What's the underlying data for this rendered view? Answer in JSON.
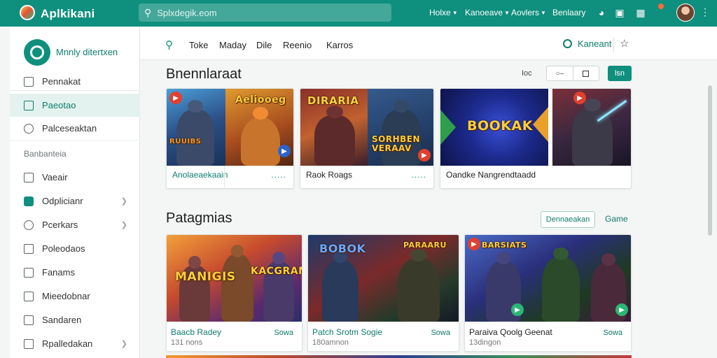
{
  "app": {
    "title": "Aplkikani"
  },
  "search": {
    "placeholder": "Splxdegik.eom"
  },
  "topnav": [
    {
      "label": "Holxe"
    },
    {
      "label": "Kanoeave"
    },
    {
      "label": "Aovlers"
    },
    {
      "label": "Benlaary"
    }
  ],
  "sidebar": {
    "profile_name": "Mnnly ditertxen",
    "items": [
      {
        "label": "Pennakat",
        "icon": "edit-icon"
      },
      {
        "label": "Paeotao",
        "icon": "calendar-icon"
      },
      {
        "label": "Palceseaktan",
        "icon": "search-icon"
      }
    ],
    "section_label": "Banbanteia",
    "items2": [
      {
        "label": "Vaeair",
        "icon": "document-icon"
      },
      {
        "label": "Odplicianr",
        "icon": "puzzle-icon"
      },
      {
        "label": "Pcerkars",
        "icon": "search-icon"
      },
      {
        "label": "Poleodaos",
        "icon": "list-icon"
      },
      {
        "label": "Fanams",
        "icon": "image-icon"
      },
      {
        "label": "Mieedobnar",
        "icon": "file-icon"
      },
      {
        "label": "Sandaren",
        "icon": "grid-icon"
      },
      {
        "label": "Rpalledakan",
        "icon": "bookmark-icon"
      }
    ]
  },
  "tabs": [
    {
      "label": "Toke"
    },
    {
      "label": "Maday"
    },
    {
      "label": "Dile"
    },
    {
      "label": "Reenio"
    },
    {
      "label": "Karros"
    }
  ],
  "header_action": {
    "label": "Kaneant"
  },
  "section1": {
    "title": "Bnennlaraat",
    "sort_label": "Ioc",
    "button_label": "lsn",
    "cards": [
      {
        "art_title": "RUUIBS",
        "name": "Anolaeaekaain",
        "tail": "....."
      },
      {
        "art_title": "Aeliooeg",
        "name": "",
        "tail": "....."
      },
      {
        "art_title": "DIRARIA",
        "name": "Raok Roags",
        "tail": "....."
      },
      {
        "art_title": "SORHBEN VERAAV",
        "name": "",
        "tail": ""
      },
      {
        "art_title": "BOOKAK",
        "name": "Oandke Nangrendtaadd",
        "tail": ""
      },
      {
        "art_title": "",
        "name": "",
        "tail": ""
      }
    ]
  },
  "section2": {
    "title": "Patagmias",
    "outline_button": "Dennaeakan",
    "link": "Game",
    "cards": [
      {
        "art_title": "MANIGIS",
        "art_title2": "KACGRAM",
        "name": "Baacb Radey",
        "sub": "131 nons",
        "link": "Sowa"
      },
      {
        "art_title": "BOBOK",
        "art_title2": "PARAARU",
        "name": "Patch Srotm Sogie",
        "sub": "180amnon",
        "link": "Sowa"
      },
      {
        "art_title": "BARSIATS",
        "art_title2": "",
        "name": "Paraiva Qoolg Geenat",
        "sub": "13dingon",
        "link": "Sowa"
      }
    ]
  }
}
